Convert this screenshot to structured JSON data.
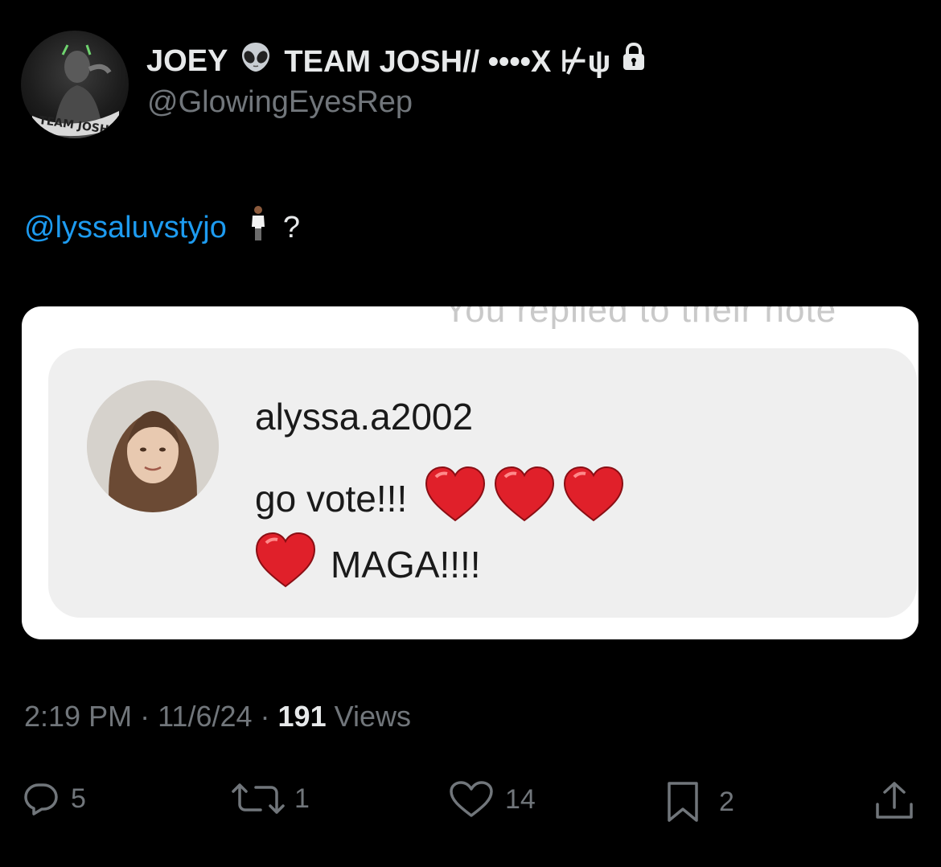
{
  "author": {
    "display_name_part1": "JOEY",
    "display_name_emoji": "alien-emoji",
    "display_name_part2": "TEAM JOSH// ••••X ⊬ψ",
    "handle": "@GlowingEyesRep",
    "avatar_caption": "TEAM JOSH"
  },
  "tweet": {
    "mention": "@lyssaluvstyjo",
    "trailing_text": "?"
  },
  "media": {
    "cut_off_text": "You replied to their note",
    "note_username": "alyssa.a2002",
    "note_line1": "go vote!!!",
    "note_line2": "MAGA!!!!"
  },
  "meta": {
    "time": "2:19 PM",
    "separator1": " · ",
    "date": "11/6/24",
    "separator2": " · ",
    "views_count": "191",
    "views_label": " Views"
  },
  "actions": {
    "replies": "5",
    "reposts": "1",
    "likes": "14",
    "bookmarks": "2"
  },
  "colors": {
    "background": "#000000",
    "primary_text": "#e7e9ea",
    "secondary_text": "#71767b",
    "link": "#1d9bf0",
    "heart": "#e0202a"
  }
}
